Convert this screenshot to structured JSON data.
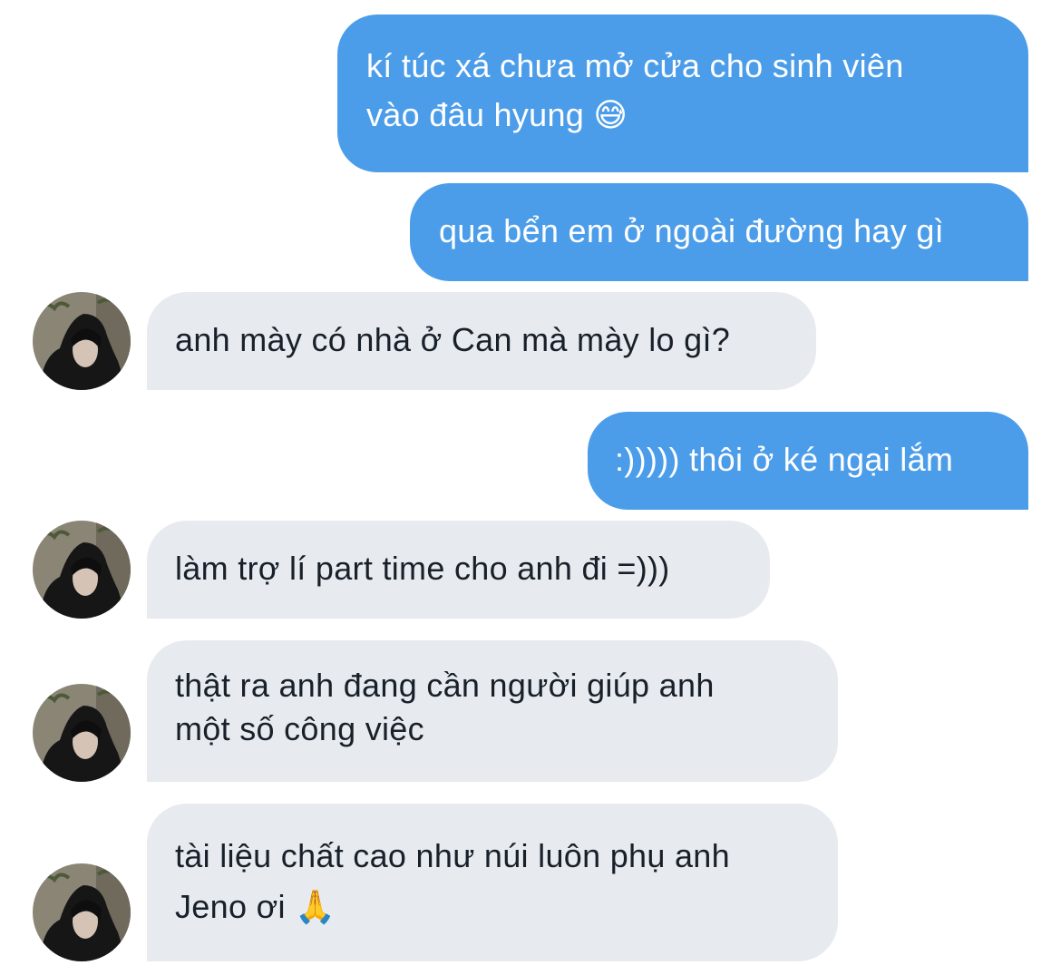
{
  "conversation": {
    "messages": [
      {
        "direction": "sent",
        "lines": [
          "kí túc xá chưa mở cửa cho sinh viên",
          "vào đâu hyung 😅"
        ]
      },
      {
        "direction": "sent",
        "lines": [
          "qua bển em ở ngoài đường hay gì"
        ]
      },
      {
        "direction": "received",
        "lines": [
          "anh mày có nhà ở Can mà mày lo gì?"
        ]
      },
      {
        "direction": "sent",
        "lines": [
          ":))))) thôi ở ké ngại lắm"
        ]
      },
      {
        "direction": "received",
        "lines": [
          "làm trợ lí part time cho anh đi =)))"
        ]
      },
      {
        "direction": "received",
        "lines": [
          "thật ra anh đang cần người giúp anh",
          "một số công việc"
        ]
      },
      {
        "direction": "received",
        "lines": [
          "tài liệu chất cao như núi luôn phụ anh",
          "Jeno ơi 🙏"
        ]
      }
    ]
  },
  "colors": {
    "sent_bubble": "#4c9de9",
    "received_bubble": "#e7ebef",
    "sent_text": "#ffffff",
    "received_text": "#18202a"
  },
  "avatar": {
    "icon": "contact-avatar-photo"
  }
}
